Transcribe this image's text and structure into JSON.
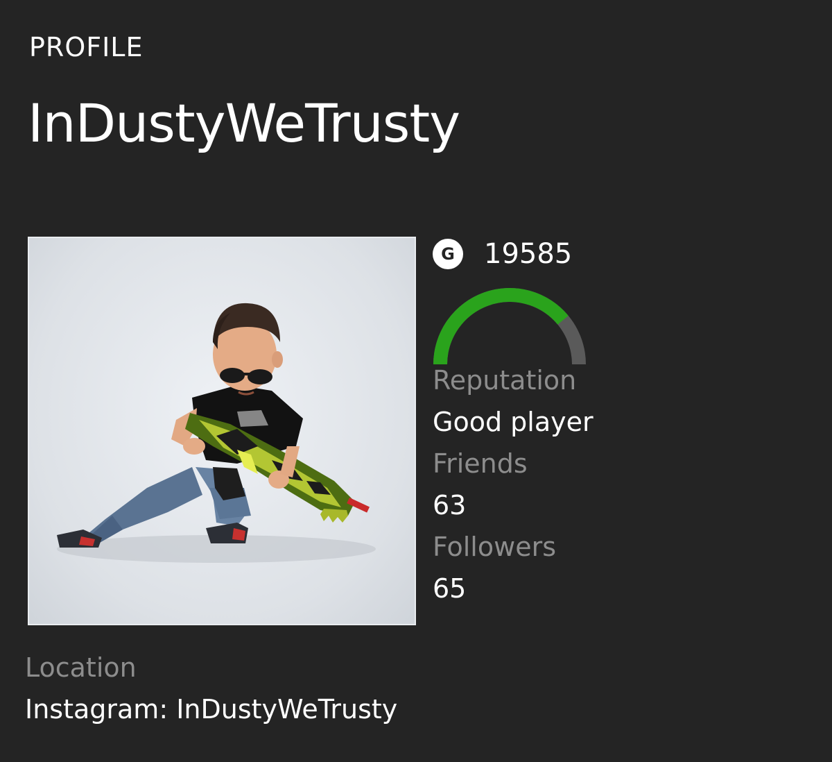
{
  "header": {
    "section_label": "PROFILE",
    "gamertag": "InDustyWeTrusty"
  },
  "avatar": {
    "alt": "Xbox avatar holding a camo chainsaw rifle"
  },
  "stats": {
    "gamerscore_icon_letter": "G",
    "gamerscore": "19585",
    "reputation_label": "Reputation",
    "reputation_value": "Good player",
    "reputation_fill_fraction": 0.78,
    "friends_label": "Friends",
    "friends_value": "63",
    "followers_label": "Followers",
    "followers_value": "65"
  },
  "location": {
    "label": "Location",
    "value": "Instagram: InDustyWeTrusty"
  },
  "colors": {
    "background": "#242424",
    "reputation_green": "#2aa31c",
    "reputation_track": "#5a5a5a",
    "muted_text": "#8d8d8d"
  }
}
